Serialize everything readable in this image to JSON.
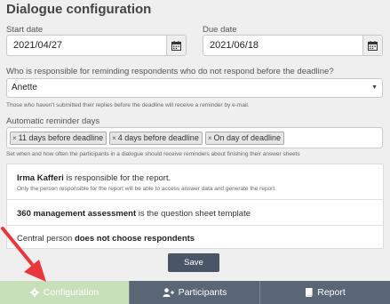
{
  "page": {
    "title": "Dialogue configuration"
  },
  "start_date": {
    "label": "Start date",
    "value": "2021/04/27"
  },
  "due_date": {
    "label": "Due date",
    "value": "2021/06/18"
  },
  "reminder_person": {
    "label": "Who is responsible for reminding respondents who do not respond before the deadline?",
    "value": "Anette",
    "help": "Those who haven't submitted their replies before the deadline will receive a reminder by e-mail."
  },
  "reminder_days": {
    "label": "Automatic reminder days",
    "tags": [
      "11 days before deadline",
      "4 days before deadline",
      "On day of deadline"
    ],
    "help": "Set when and how often the participants in a dialogue should receive reminders about finishing their answer sheets"
  },
  "info_panel": {
    "responsible_name": "Irma Kafferi",
    "responsible_suffix": " is responsible for the report.",
    "responsible_note": "Only the person responsible for the report will be able to access answer data and generate the report.",
    "template_name": "360 management assessment",
    "template_suffix": " is the question sheet template",
    "central_prefix": "Central person ",
    "central_bold": "does not choose respondents"
  },
  "save_label": "Save",
  "tabs": [
    {
      "label": "Configuration",
      "icon": "gear-icon",
      "active": true
    },
    {
      "label": "Participants",
      "icon": "users-icon",
      "active": false
    },
    {
      "label": "Report",
      "icon": "book-icon",
      "active": false
    }
  ],
  "colors": {
    "active_tab": "#c7e0ba",
    "inactive_tab": "#5a6576",
    "save_button": "#4a5568",
    "annotation_arrow": "#e8383d"
  }
}
